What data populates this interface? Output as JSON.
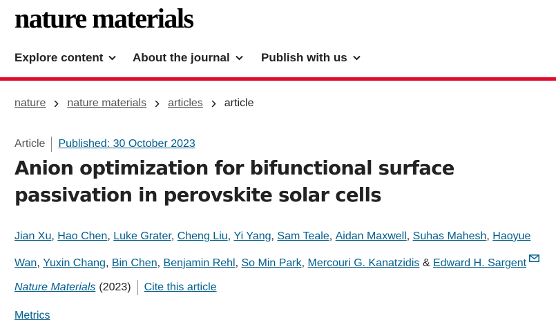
{
  "masthead": {
    "logo_text": "nature materials"
  },
  "nav": [
    {
      "label": "Explore content"
    },
    {
      "label": "About the journal"
    },
    {
      "label": "Publish with us"
    }
  ],
  "breadcrumb": {
    "items": [
      "nature",
      "nature materials",
      "articles"
    ],
    "current": "article"
  },
  "article": {
    "type": "Article",
    "published": "Published: 30 October 2023",
    "title": "Anion optimization for bifunctional surface passivation in perovskite solar cells",
    "authors": [
      "Jian Xu",
      "Hao Chen",
      "Luke Grater",
      "Cheng Liu",
      "Yi Yang",
      "Sam Teale",
      "Aidan Maxwell",
      "Suhas Mahesh",
      "Haoyue Wan",
      "Yuxin Chang",
      "Bin Chen",
      "Benjamin Rehl",
      "So Min Park",
      "Mercouri G. Kanatzidis",
      "Edward H. Sargent"
    ],
    "author_separator": ", ",
    "last_separator": " & ",
    "journal": "Nature Materials",
    "year": "(2023)",
    "cite_label": "Cite this article",
    "metrics_label": "Metrics"
  },
  "colors": {
    "accent_red": "#e00c2b",
    "link_blue": "#025e8d",
    "text": "#222222"
  },
  "icons": {
    "nav_dropdown": "chevron-down-icon",
    "breadcrumb_separator": "chevron-right-icon",
    "corresponding_author": "mail-icon"
  }
}
